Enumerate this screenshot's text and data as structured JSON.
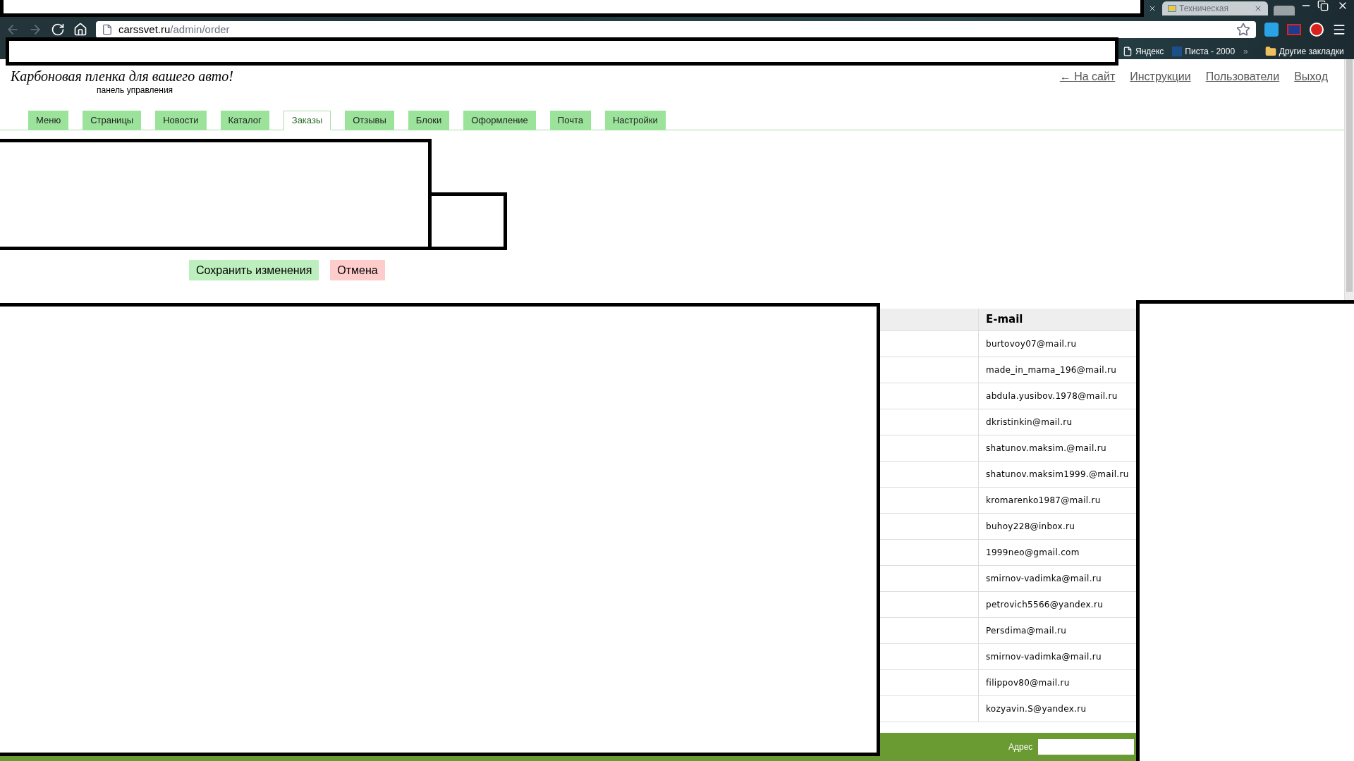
{
  "browser": {
    "tab_title": "Техническая",
    "url_host": "carssvet.ru",
    "url_path": "/admin/order",
    "bookmarks": [
      {
        "label": "Яндекс",
        "kind": "page"
      },
      {
        "label": "Писта - 2000",
        "kind": "site"
      }
    ],
    "overflow": "»",
    "other_bookmarks": "Другие закладки"
  },
  "header": {
    "title": "Карбоновая пленка для вашего авто!",
    "subtitle": "панель управления",
    "links": [
      "← На сайт",
      "Инструкции",
      "Пользователи",
      "Выход"
    ]
  },
  "tabs": [
    {
      "label": "Меню",
      "selected": false
    },
    {
      "label": "Страницы",
      "selected": false
    },
    {
      "label": "Новости",
      "selected": false
    },
    {
      "label": "Каталог",
      "selected": false
    },
    {
      "label": "Заказы",
      "selected": true
    },
    {
      "label": "Отзывы",
      "selected": false
    },
    {
      "label": "Блоки",
      "selected": false
    },
    {
      "label": "Оформление",
      "selected": false
    },
    {
      "label": "Почта",
      "selected": false
    },
    {
      "label": "Настройки",
      "selected": false
    }
  ],
  "buttons": {
    "save": "Сохранить изменения",
    "cancel": "Отмена"
  },
  "table": {
    "columns": [
      "E-mail"
    ],
    "rows": [
      "burtovoy07@mail.ru",
      "made_in_mama_196@mail.ru",
      "abdula.yusibov.1978@mail.ru",
      "dkristinkin@mail.ru",
      "shatunov.maksim.@mail.ru",
      "shatunov.maksim1999.@mail.ru",
      "kromarenko1987@mail.ru",
      "buhoy228@inbox.ru",
      "1999neo@gmail.com",
      "smirnov-vadimka@mail.ru",
      "petrovich5566@yandex.ru",
      "Persdima@mail.ru",
      "smirnov-vadimka@mail.ru",
      "filippov80@mail.ru",
      "kozyavin.S@yandex.ru"
    ]
  },
  "taskbar": {
    "address_label": "Адрес"
  }
}
